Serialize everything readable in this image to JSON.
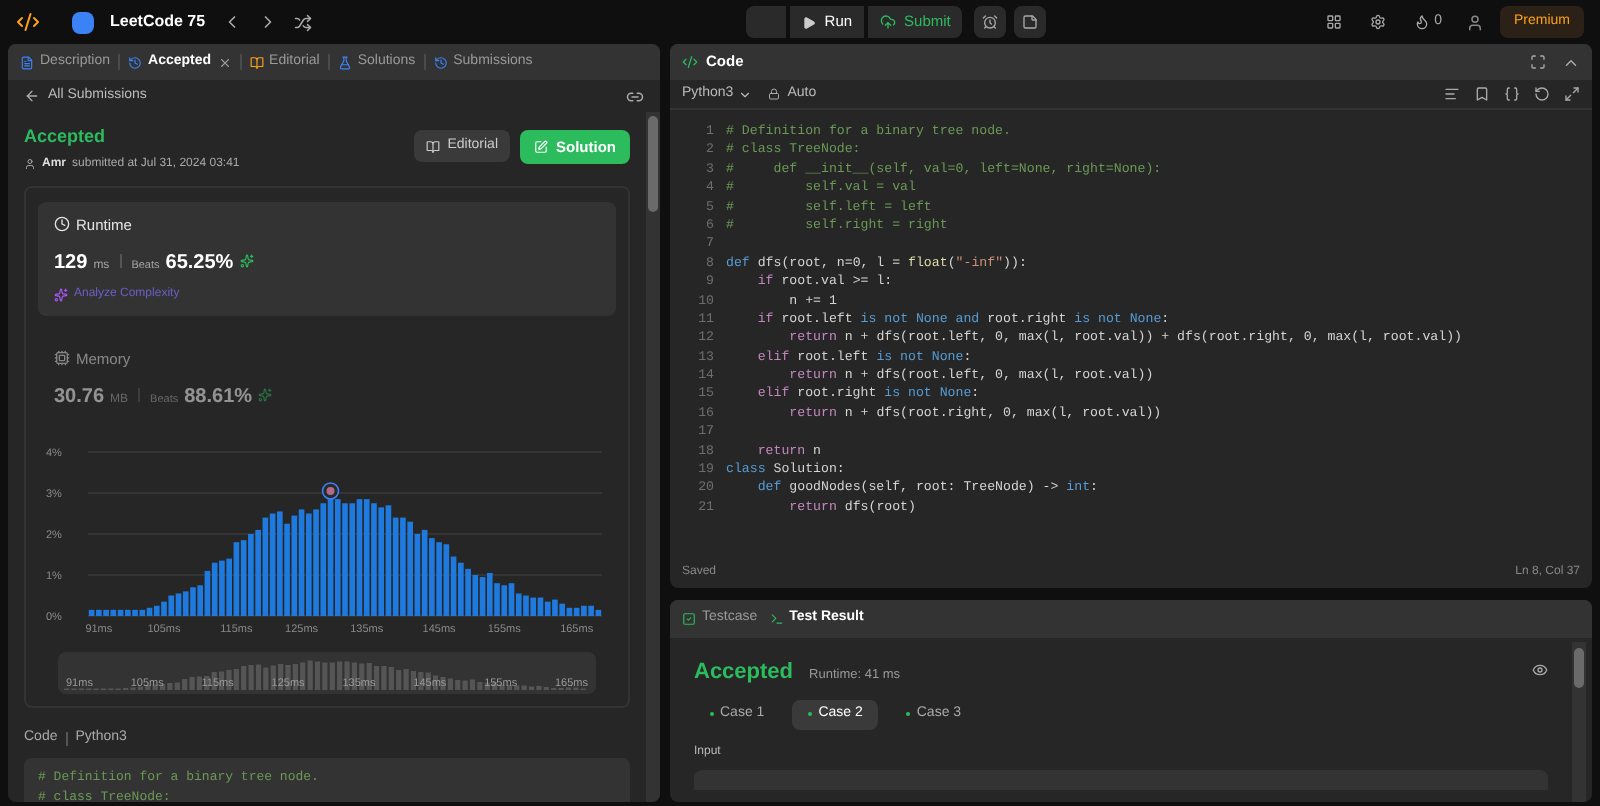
{
  "topbar": {
    "title": "LeetCode 75",
    "run": "Run",
    "submit": "Submit",
    "streak": "0",
    "premium": "Premium"
  },
  "left_tabs": [
    {
      "label": "Description",
      "selected": false,
      "closable": false
    },
    {
      "label": "Accepted",
      "selected": true,
      "closable": true
    },
    {
      "label": "Editorial",
      "selected": false,
      "closable": false
    },
    {
      "label": "Solutions",
      "selected": false,
      "closable": false
    },
    {
      "label": "Submissions",
      "selected": false,
      "closable": false
    }
  ],
  "back_link": "All Submissions",
  "result": {
    "status": "Accepted",
    "user": "Amr",
    "submitted": "submitted at Jul 31, 2024 03:41",
    "editorial": "Editorial",
    "solution": "Solution"
  },
  "runtime": {
    "title": "Runtime",
    "value": "129",
    "unit": "ms",
    "beats_label": "Beats",
    "beats": "65.25%",
    "analyze": "Analyze Complexity",
    "selected": true
  },
  "memory": {
    "title": "Memory",
    "value": "30.76",
    "unit": "MB",
    "beats_label": "Beats",
    "beats": "88.61%",
    "selected": false
  },
  "chart": {
    "chart_data": {
      "type": "bar",
      "values": [
        0.15,
        0.15,
        0.15,
        0.15,
        0.15,
        0.15,
        0.15,
        0.15,
        0.2,
        0.25,
        0.35,
        0.5,
        0.55,
        0.6,
        0.7,
        0.75,
        1.1,
        1.3,
        1.35,
        1.4,
        1.8,
        1.85,
        2.0,
        2.1,
        2.4,
        2.5,
        2.55,
        2.25,
        2.45,
        2.6,
        2.5,
        2.6,
        2.75,
        2.95,
        2.85,
        2.75,
        2.75,
        2.85,
        2.85,
        2.75,
        2.65,
        2.7,
        2.4,
        2.4,
        2.3,
        2.0,
        2.1,
        1.9,
        1.8,
        1.75,
        1.45,
        1.3,
        1.15,
        1.0,
        0.95,
        1.05,
        0.8,
        0.75,
        0.8,
        0.55,
        0.5,
        0.45,
        0.45,
        0.35,
        0.4,
        0.3,
        0.2,
        0.2,
        0.25,
        0.25,
        0.15
      ],
      "ylim": [
        0,
        4
      ],
      "yticks": [
        {
          "value": 0,
          "label": "0%"
        },
        {
          "value": 1,
          "label": "1%"
        },
        {
          "value": 2,
          "label": "2%"
        },
        {
          "value": 3,
          "label": "3%"
        },
        {
          "value": 4,
          "label": "4%"
        }
      ],
      "grid": true,
      "categories": [
        null,
        "91ms",
        null,
        null,
        null,
        null,
        null,
        null,
        null,
        null,
        "105ms",
        null,
        null,
        null,
        null,
        null,
        null,
        null,
        null,
        null,
        "115ms",
        null,
        null,
        null,
        null,
        null,
        null,
        null,
        null,
        "125ms",
        null,
        null,
        null,
        null,
        null,
        null,
        null,
        null,
        "135ms",
        null,
        null,
        null,
        null,
        null,
        null,
        null,
        null,
        null,
        "145ms",
        null,
        null,
        null,
        null,
        null,
        null,
        null,
        null,
        "155ms",
        null,
        null,
        null,
        null,
        null,
        null,
        null,
        null,
        null,
        "165ms",
        null,
        null,
        null
      ]
    }
  },
  "navigator": {
    "labels": [
      "91ms",
      "105ms",
      "115ms",
      "125ms",
      "135ms",
      "145ms",
      "155ms",
      "165ms"
    ]
  },
  "code_header": {
    "label": "Code",
    "language": "Python3"
  },
  "code_preview": [
    [
      {
        "text": "# Definition for a binary tree node.",
        "kind": "cm"
      }
    ],
    [
      {
        "text": "# class TreeNode:",
        "kind": "cm"
      }
    ]
  ],
  "editor": {
    "title": "Code",
    "language": "Python3",
    "mode": "Auto",
    "status": "Saved",
    "cursor": "Ln 8, Col 37",
    "lines": [
      {
        "number": "1",
        "tokens": [
          {
            "text": "# Definition for a binary tree node.",
            "kind": "cm"
          }
        ]
      },
      {
        "number": "2",
        "tokens": [
          {
            "text": "# class TreeNode:",
            "kind": "cm"
          }
        ]
      },
      {
        "number": "3",
        "tokens": [
          {
            "text": "#     def __init__(self, val=0, left=None, right=None):",
            "kind": "cm"
          }
        ]
      },
      {
        "number": "4",
        "tokens": [
          {
            "text": "#         self.val = val",
            "kind": "cm"
          }
        ]
      },
      {
        "number": "5",
        "tokens": [
          {
            "text": "#         self.left = left",
            "kind": "cm"
          }
        ]
      },
      {
        "number": "6",
        "tokens": [
          {
            "text": "#         self.right = right",
            "kind": "cm"
          }
        ]
      },
      {
        "number": "7"
      },
      {
        "number": "8",
        "tokens": [
          {
            "text": "def",
            "kind": "op"
          },
          {
            "text": " dfs(root, n=0, l = ",
            "kind": "plain"
          },
          {
            "text": "float",
            "kind": "fn"
          },
          {
            "text": "(",
            "kind": "plain"
          },
          {
            "text": "\"-inf\"",
            "kind": "str"
          },
          {
            "text": ")):",
            "kind": "plain"
          }
        ]
      },
      {
        "number": "9",
        "tokens": [
          {
            "text": "    if",
            "kind": "kw"
          },
          {
            "text": " root.val >= l:",
            "kind": "plain"
          }
        ]
      },
      {
        "number": "10",
        "tokens": [
          {
            "text": "        n += 1",
            "kind": "plain"
          }
        ]
      },
      {
        "number": "11",
        "tokens": [
          {
            "text": "    if",
            "kind": "kw"
          },
          {
            "text": " root.left ",
            "kind": "plain"
          },
          {
            "text": "is not None and",
            "kind": "op"
          },
          {
            "text": " root.right ",
            "kind": "plain"
          },
          {
            "text": "is not None",
            "kind": "op"
          },
          {
            "text": ":",
            "kind": "plain"
          }
        ]
      },
      {
        "number": "12",
        "tokens": [
          {
            "text": "        return",
            "kind": "kw"
          },
          {
            "text": " n + dfs(root.left, 0, max(l, root.val)) + dfs(root.right, 0, max(l, root.val))",
            "kind": "plain"
          }
        ]
      },
      {
        "number": "13",
        "tokens": [
          {
            "text": "    elif",
            "kind": "kw"
          },
          {
            "text": " root.left ",
            "kind": "plain"
          },
          {
            "text": "is not None",
            "kind": "op"
          },
          {
            "text": ":",
            "kind": "plain"
          }
        ]
      },
      {
        "number": "14",
        "tokens": [
          {
            "text": "        return",
            "kind": "kw"
          },
          {
            "text": " n + dfs(root.left, 0, max(l, root.val))",
            "kind": "plain"
          }
        ]
      },
      {
        "number": "15",
        "tokens": [
          {
            "text": "    elif",
            "kind": "kw"
          },
          {
            "text": " root.right ",
            "kind": "plain"
          },
          {
            "text": "is not None",
            "kind": "op"
          },
          {
            "text": ":",
            "kind": "plain"
          }
        ]
      },
      {
        "number": "16",
        "tokens": [
          {
            "text": "        return",
            "kind": "kw"
          },
          {
            "text": " n + dfs(root.right, 0, max(l, root.val))",
            "kind": "plain"
          }
        ]
      },
      {
        "number": "17"
      },
      {
        "number": "18",
        "tokens": [
          {
            "text": "    return",
            "kind": "kw"
          },
          {
            "text": " n",
            "kind": "plain"
          }
        ]
      },
      {
        "number": "19",
        "tokens": [
          {
            "text": "class",
            "kind": "op"
          },
          {
            "text": " Solution:",
            "kind": "plain"
          }
        ]
      },
      {
        "number": "20",
        "tokens": [
          {
            "text": "    def",
            "kind": "op"
          },
          {
            "text": " goodNodes(self, root: TreeNode) -> ",
            "kind": "plain"
          },
          {
            "text": "int",
            "kind": "op"
          },
          {
            "text": ":",
            "kind": "plain"
          }
        ]
      },
      {
        "number": "21",
        "tokens": [
          {
            "text": "        return",
            "kind": "kw"
          },
          {
            "text": " dfs(root)",
            "kind": "plain"
          }
        ]
      }
    ]
  },
  "test": {
    "tabs": [
      {
        "label": "Testcase",
        "selected": false
      },
      {
        "label": "Test Result",
        "selected": true
      }
    ],
    "status": "Accepted",
    "runtime": "Runtime: 41 ms",
    "cases": [
      {
        "label": "Case 1",
        "selected": false,
        "color": "#2cbb5d"
      },
      {
        "label": "Case 2",
        "selected": true,
        "color": "#2cbb5d"
      },
      {
        "label": "Case 3",
        "selected": false,
        "color": "#2cbb5d"
      }
    ],
    "input_label": "Input"
  }
}
